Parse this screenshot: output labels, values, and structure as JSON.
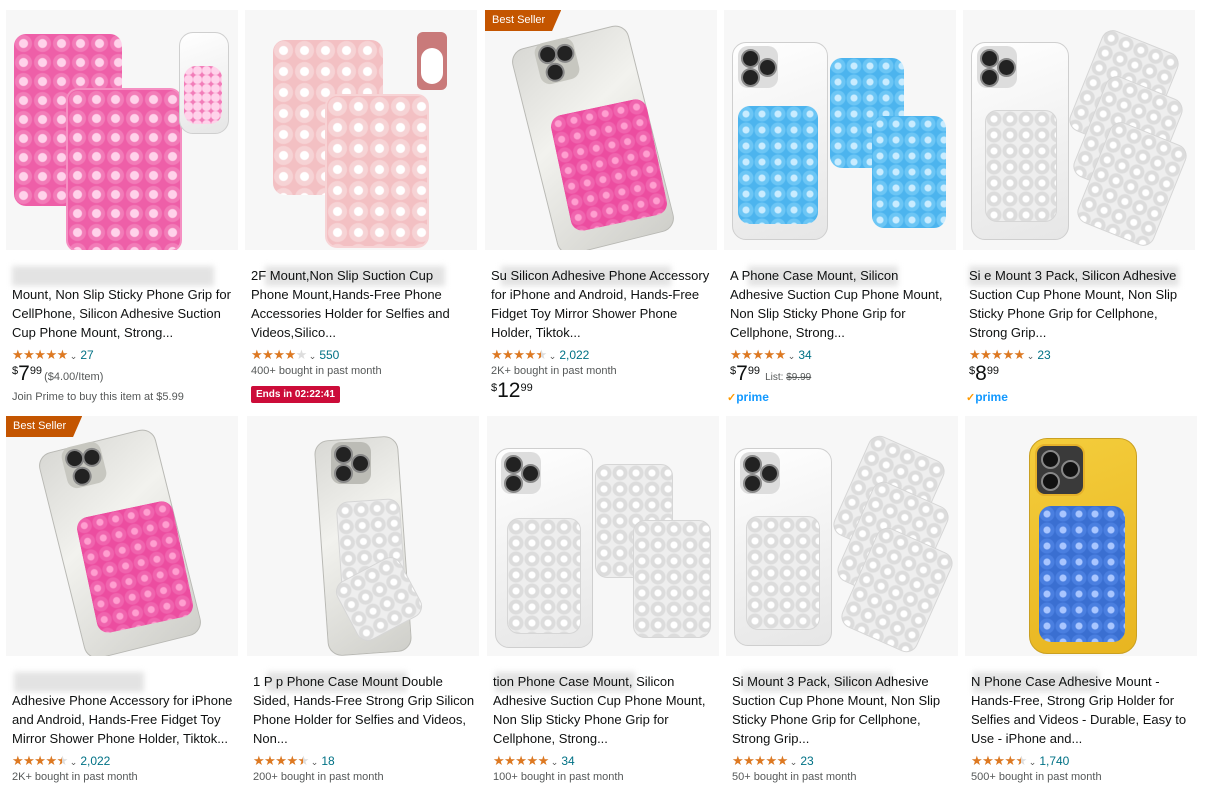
{
  "colors": {
    "star": "#de7921",
    "link": "#007185",
    "badge": "#c45500",
    "deal": "#cc0c39",
    "prime": "#1399ff"
  },
  "products": [
    {
      "badge": "",
      "title": "Mount, Non Slip Sticky Phone Grip for CellPhone, Silicon Adhesive Suction Cup Phone Mount, Strong...",
      "rating": 5,
      "reviews": "27",
      "bought": "",
      "price_symbol": "$",
      "price_whole": "7",
      "price_fraction": "99",
      "unit_price": "($4.00/Item)",
      "list_label": "",
      "list_price": "",
      "deal": "",
      "note": "Join Prime to buy this item at $5.99",
      "prime": false
    },
    {
      "badge": "",
      "title": "2F Mount,Non Slip Suction Cup Phone Mount,Hands-Free Phone Accessories Holder for Selfies and Videos,Silico...",
      "rating": 4,
      "reviews": "550",
      "bought": "400+ bought in past month",
      "price_symbol": "",
      "price_whole": "",
      "price_fraction": "",
      "unit_price": "",
      "list_label": "",
      "list_price": "",
      "deal": "Ends in 02:22:41",
      "note": "",
      "prime": false
    },
    {
      "badge": "Best Seller",
      "title": "Su Silicon Adhesive Phone Accessory for iPhone and Android, Hands-Free Fidget Toy Mirror Shower Phone Holder, Tiktok...",
      "rating": 4.5,
      "reviews": "2,022",
      "bought": "2K+ bought in past month",
      "price_symbol": "$",
      "price_whole": "12",
      "price_fraction": "99",
      "unit_price": "",
      "list_label": "",
      "list_price": "",
      "deal": "",
      "note": "",
      "prime": false
    },
    {
      "badge": "",
      "title": "A Phone Case Mount, Silicon Adhesive Suction Cup Phone Mount, Non Slip Sticky Phone Grip for Cellphone, Strong...",
      "rating": 5,
      "reviews": "34",
      "bought": "",
      "price_symbol": "$",
      "price_whole": "7",
      "price_fraction": "99",
      "unit_price": "",
      "list_label": "List:",
      "list_price": "$9.99",
      "deal": "",
      "note": "",
      "prime": true
    },
    {
      "badge": "",
      "title": "Si e Mount 3 Pack, Silicon Adhesive Suction Cup Phone Mount, Non Slip Sticky Phone Grip for Cellphone, Strong Grip...",
      "rating": 5,
      "reviews": "23",
      "bought": "",
      "price_symbol": "$",
      "price_whole": "8",
      "price_fraction": "99",
      "unit_price": "",
      "list_label": "",
      "list_price": "",
      "deal": "",
      "note": "",
      "prime": true
    },
    {
      "badge": "Best Seller",
      "title": "Adhesive Phone Accessory for iPhone and Android, Hands-Free Fidget Toy Mirror Shower Phone Holder, Tiktok...",
      "rating": 4.5,
      "reviews": "2,022",
      "bought": "2K+ bought in past month",
      "price_symbol": "",
      "price_whole": "",
      "price_fraction": "",
      "unit_price": "",
      "list_label": "",
      "list_price": "",
      "deal": "",
      "note": "",
      "prime": false
    },
    {
      "badge": "",
      "title": "1 P p Phone Case Mount Double Sided, Hands-Free Strong Grip Silicon Phone Holder for Selfies and Videos, Non...",
      "rating": 4.5,
      "reviews": "18",
      "bought": "200+ bought in past month",
      "price_symbol": "",
      "price_whole": "",
      "price_fraction": "",
      "unit_price": "",
      "list_label": "",
      "list_price": "",
      "deal": "",
      "note": "",
      "prime": false
    },
    {
      "badge": "",
      "title": "tion Phone Case Mount, Silicon Adhesive Suction Cup Phone Mount, Non Slip Sticky Phone Grip for Cellphone, Strong...",
      "rating": 5,
      "reviews": "34",
      "bought": "100+ bought in past month",
      "price_symbol": "",
      "price_whole": "",
      "price_fraction": "",
      "unit_price": "",
      "list_label": "",
      "list_price": "",
      "deal": "",
      "note": "",
      "prime": false
    },
    {
      "badge": "",
      "title": "Si Mount 3 Pack, Silicon Adhesive Suction Cup Phone Mount, Non Slip Sticky Phone Grip for Cellphone, Strong Grip...",
      "rating": 5,
      "reviews": "23",
      "bought": "50+ bought in past month",
      "price_symbol": "",
      "price_whole": "",
      "price_fraction": "",
      "unit_price": "",
      "list_label": "",
      "list_price": "",
      "deal": "",
      "note": "",
      "prime": false
    },
    {
      "badge": "",
      "title": "N Phone Case Adhesive Mount - Hands-Free, Strong Grip Holder for Selfies and Videos - Durable, Easy to Use - iPhone and...",
      "rating": 4.5,
      "reviews": "1,740",
      "bought": "500+ bought in past month",
      "price_symbol": "",
      "price_whole": "",
      "price_fraction": "",
      "unit_price": "",
      "list_label": "",
      "list_price": "",
      "deal": "",
      "note": "",
      "prime": false
    }
  ]
}
